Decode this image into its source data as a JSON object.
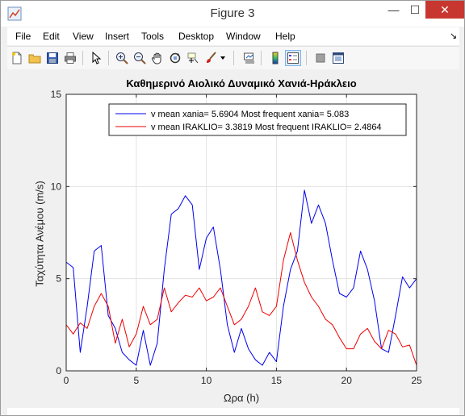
{
  "window": {
    "title": "Figure 3",
    "minimize_glyph": "—",
    "maximize_glyph": "☐",
    "close_glyph": "✕",
    "close_color": "#c7372f"
  },
  "menu": {
    "items": [
      "File",
      "Edit",
      "View",
      "Insert",
      "Tools",
      "Desktop",
      "Window",
      "Help"
    ],
    "dock_glyph": "↘"
  },
  "toolbar": {
    "icons": [
      "new-figure-icon",
      "open-file-icon",
      "save-icon",
      "print-icon",
      "select-arrow-icon",
      "zoom-in-icon",
      "zoom-out-icon",
      "pan-icon",
      "rotate-3d-icon",
      "data-cursor-icon",
      "brush-icon",
      "brush-dropdown-icon",
      "link-plot-icon",
      "colorbar-icon",
      "legend-icon",
      "hide-plot-tools-icon",
      "show-plot-tools-icon"
    ],
    "active": "legend-icon"
  },
  "chart_data": {
    "type": "line",
    "title": "Καθημερινό Αιολικό Δυναμικό Χανιά-Ηράκλειο",
    "xlabel": "Ωρα (h)",
    "ylabel": "Ταχύτητα Ανέμου (m/s)",
    "xlim": [
      0,
      25
    ],
    "ylim": [
      0,
      15
    ],
    "xticks": [
      "0",
      "5",
      "10",
      "15",
      "20",
      "25"
    ],
    "yticks": [
      "0",
      "5",
      "10",
      "15"
    ],
    "grid": true,
    "legend_position": "top-right",
    "x": [
      0,
      0.5,
      1,
      1.5,
      2,
      2.5,
      3,
      3.5,
      4,
      4.5,
      5,
      5.5,
      6,
      6.5,
      7,
      7.5,
      8,
      8.5,
      9,
      9.5,
      10,
      10.5,
      11,
      11.5,
      12,
      12.5,
      13,
      13.5,
      14,
      14.5,
      15,
      15.5,
      16,
      16.5,
      17,
      17.5,
      18,
      18.5,
      19,
      19.5,
      20,
      20.5,
      21,
      21.5,
      22,
      22.5,
      23,
      23.5,
      24,
      24.5,
      25
    ],
    "series": [
      {
        "name": "v mean xania= 5.6904 Most frequent xania= 5.083",
        "color": "#0000ee",
        "values": [
          5.9,
          5.6,
          1.0,
          3.5,
          6.5,
          6.8,
          3.0,
          2.3,
          1.0,
          0.6,
          0.3,
          2.2,
          0.3,
          1.5,
          5.5,
          8.5,
          8.8,
          9.5,
          9.0,
          5.5,
          7.2,
          7.8,
          5.5,
          2.5,
          1.0,
          2.3,
          1.2,
          0.6,
          0.3,
          1.0,
          0.5,
          3.5,
          5.5,
          6.5,
          9.8,
          8.0,
          9.0,
          8.0,
          6.0,
          4.2,
          4.0,
          4.5,
          6.5,
          5.5,
          3.8,
          1.2,
          1.0,
          3.0,
          5.1,
          4.5,
          5.0
        ]
      },
      {
        "name": "v mean IRAKLIO= 3.3819 Most frequent IRAKLIO= 2.4864",
        "color": "#ee0000",
        "values": [
          2.5,
          2.0,
          2.6,
          2.3,
          3.5,
          4.2,
          3.5,
          1.5,
          2.8,
          1.3,
          2.0,
          3.5,
          2.5,
          2.8,
          4.5,
          3.2,
          3.7,
          4.1,
          4.0,
          4.5,
          3.8,
          4.0,
          4.5,
          3.5,
          2.5,
          2.8,
          3.5,
          4.5,
          3.2,
          3.0,
          3.5,
          6.0,
          7.5,
          6.0,
          4.8,
          4.0,
          3.5,
          2.8,
          2.5,
          1.8,
          1.2,
          1.2,
          2.0,
          2.3,
          1.6,
          1.2,
          2.2,
          2.0,
          1.3,
          1.4,
          0.3
        ]
      }
    ]
  }
}
